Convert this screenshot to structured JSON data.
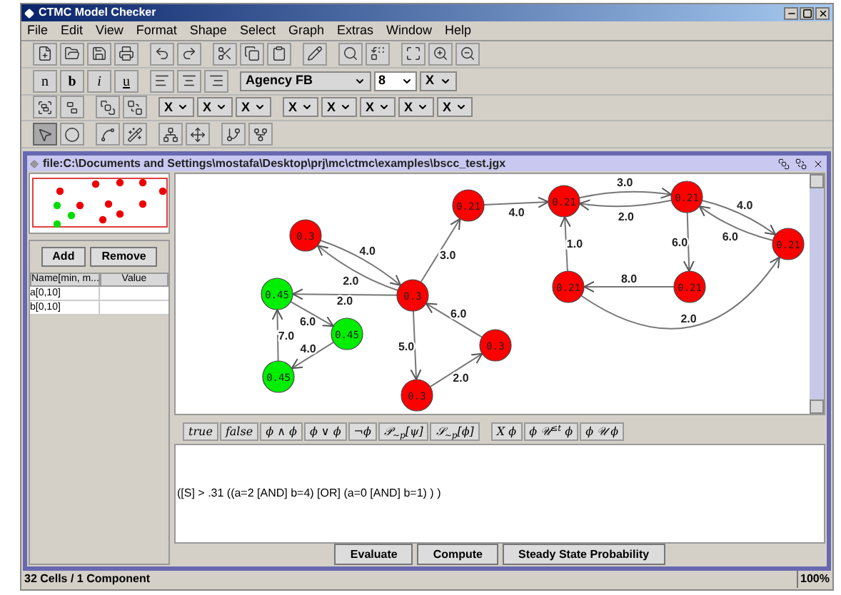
{
  "window": {
    "title": "CTMC Model Checker"
  },
  "menu": [
    "File",
    "Edit",
    "View",
    "Format",
    "Shape",
    "Select",
    "Graph",
    "Extras",
    "Window",
    "Help"
  ],
  "format_bar": {
    "styles": [
      "n",
      "b",
      "i",
      "u"
    ],
    "font": "Agency FB",
    "size": "8",
    "arrow": "X"
  },
  "attribute_bar": {
    "dropdowns": [
      "X",
      "X",
      "X",
      "X",
      "X",
      "X",
      "X",
      "X"
    ]
  },
  "tools": [
    {
      "selected": true
    },
    {
      "selected": false
    },
    {
      "selected": false
    },
    {
      "selected": false
    },
    {
      "selected": false
    },
    {
      "selected": false
    },
    {
      "selected": false
    },
    {
      "selected": false
    }
  ],
  "document": {
    "title": "file:C:\\Documents and Settings\\mostafa\\Desktop\\prj\\mc\\ctmc\\examples\\bscc_test.jgx"
  },
  "variables": {
    "buttons": [
      "Add",
      "Remove"
    ],
    "columns": [
      "Name[min, m...",
      "Value"
    ],
    "rows": [
      {
        "name": "a[0,10]"
      },
      {
        "name": "b[0,10]"
      }
    ]
  },
  "graph": {
    "nodes": [
      {
        "label": "0.3",
        "color": "#ff0000"
      },
      {
        "label": "0.21",
        "color": "#ff0000"
      },
      {
        "label": "0.21",
        "color": "#ff0000"
      },
      {
        "label": "0.21",
        "color": "#ff0000"
      },
      {
        "label": "0.21",
        "color": "#ff0000"
      },
      {
        "label": "0.21",
        "color": "#ff0000"
      },
      {
        "label": "0.21",
        "color": "#ff0000"
      },
      {
        "label": "0.3",
        "color": "#ff0000"
      },
      {
        "label": "0.45",
        "color": "#00ee00"
      },
      {
        "label": "0.45",
        "color": "#00ee00"
      },
      {
        "label": "0.45",
        "color": "#00ee00"
      },
      {
        "label": "0.3",
        "color": "#ff0000"
      },
      {
        "label": "0.3",
        "color": "#ff0000"
      }
    ],
    "edges": [
      {
        "label": "4.0"
      },
      {
        "label": "2.0"
      },
      {
        "label": "2.0"
      },
      {
        "label": "3.0"
      },
      {
        "label": "5.0"
      },
      {
        "label": "6.0"
      },
      {
        "label": "2.0"
      },
      {
        "label": "6.0"
      },
      {
        "label": "4.0"
      },
      {
        "label": "7.0"
      },
      {
        "label": "4.0"
      },
      {
        "label": "3.0"
      },
      {
        "label": "2.0"
      },
      {
        "label": "4.0"
      },
      {
        "label": "6.0"
      },
      {
        "label": "6.0"
      },
      {
        "label": "8.0"
      },
      {
        "label": "1.0"
      },
      {
        "label": "2.0"
      }
    ]
  },
  "formula_bar": {
    "state_formulas": [
      "true",
      "false",
      "ϕ ∧ ϕ",
      "ϕ ∨ ϕ",
      "¬ϕ",
      "𝒫$_{∼p}$[ψ]",
      "𝒮$_{∼p}$[ϕ]"
    ],
    "path_formulas": [
      "X ϕ",
      "ϕ 𝒰$^{≤t}$ ϕ",
      "ϕ 𝒰 ϕ"
    ]
  },
  "formula": "([S] > .31 ((a=2 [AND] b=4)  [OR] (a=0 [AND] b=1) ) )",
  "actions": [
    "Evaluate",
    "Compute",
    "Steady State Probability"
  ],
  "status_bar": {
    "text": "32 Cells / 1 Component",
    "zoom": "100%"
  }
}
